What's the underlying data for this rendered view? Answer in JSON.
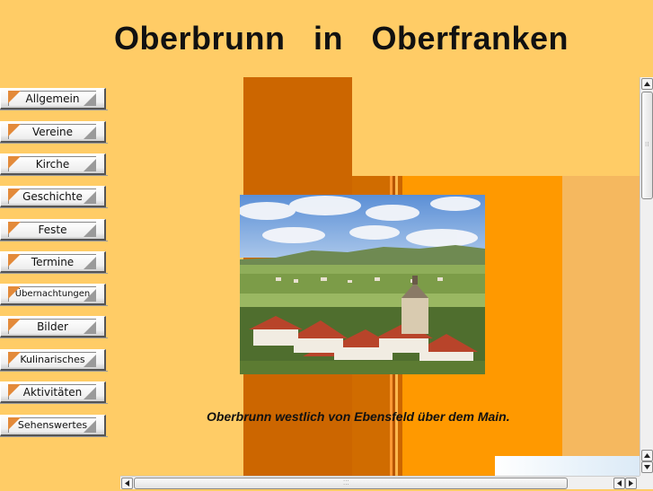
{
  "header": {
    "title": "Oberbrunn   in   Oberfranken"
  },
  "nav": {
    "items": [
      {
        "label": "Allgemein"
      },
      {
        "label": "Vereine"
      },
      {
        "label": "Kirche"
      },
      {
        "label": "Geschichte"
      },
      {
        "label": "Feste"
      },
      {
        "label": "Termine"
      },
      {
        "label": "Übernachtungen"
      },
      {
        "label": "Bilder"
      },
      {
        "label": "Kulinarisches"
      },
      {
        "label": "Aktivitäten"
      },
      {
        "label": "Sehenswertes"
      }
    ]
  },
  "main": {
    "caption": "Oberbrunn westlich von Ebensfeld über dem Main."
  },
  "colors": {
    "page_background": "#ffcc66",
    "band_dark": "#cc6600",
    "band_orange": "#ff9900",
    "band_light": "#f5b85f"
  },
  "icons": {
    "scroll_up": "triangle-up-icon",
    "scroll_down": "triangle-down-icon",
    "scroll_left": "triangle-left-icon",
    "scroll_right": "triangle-right-icon"
  }
}
